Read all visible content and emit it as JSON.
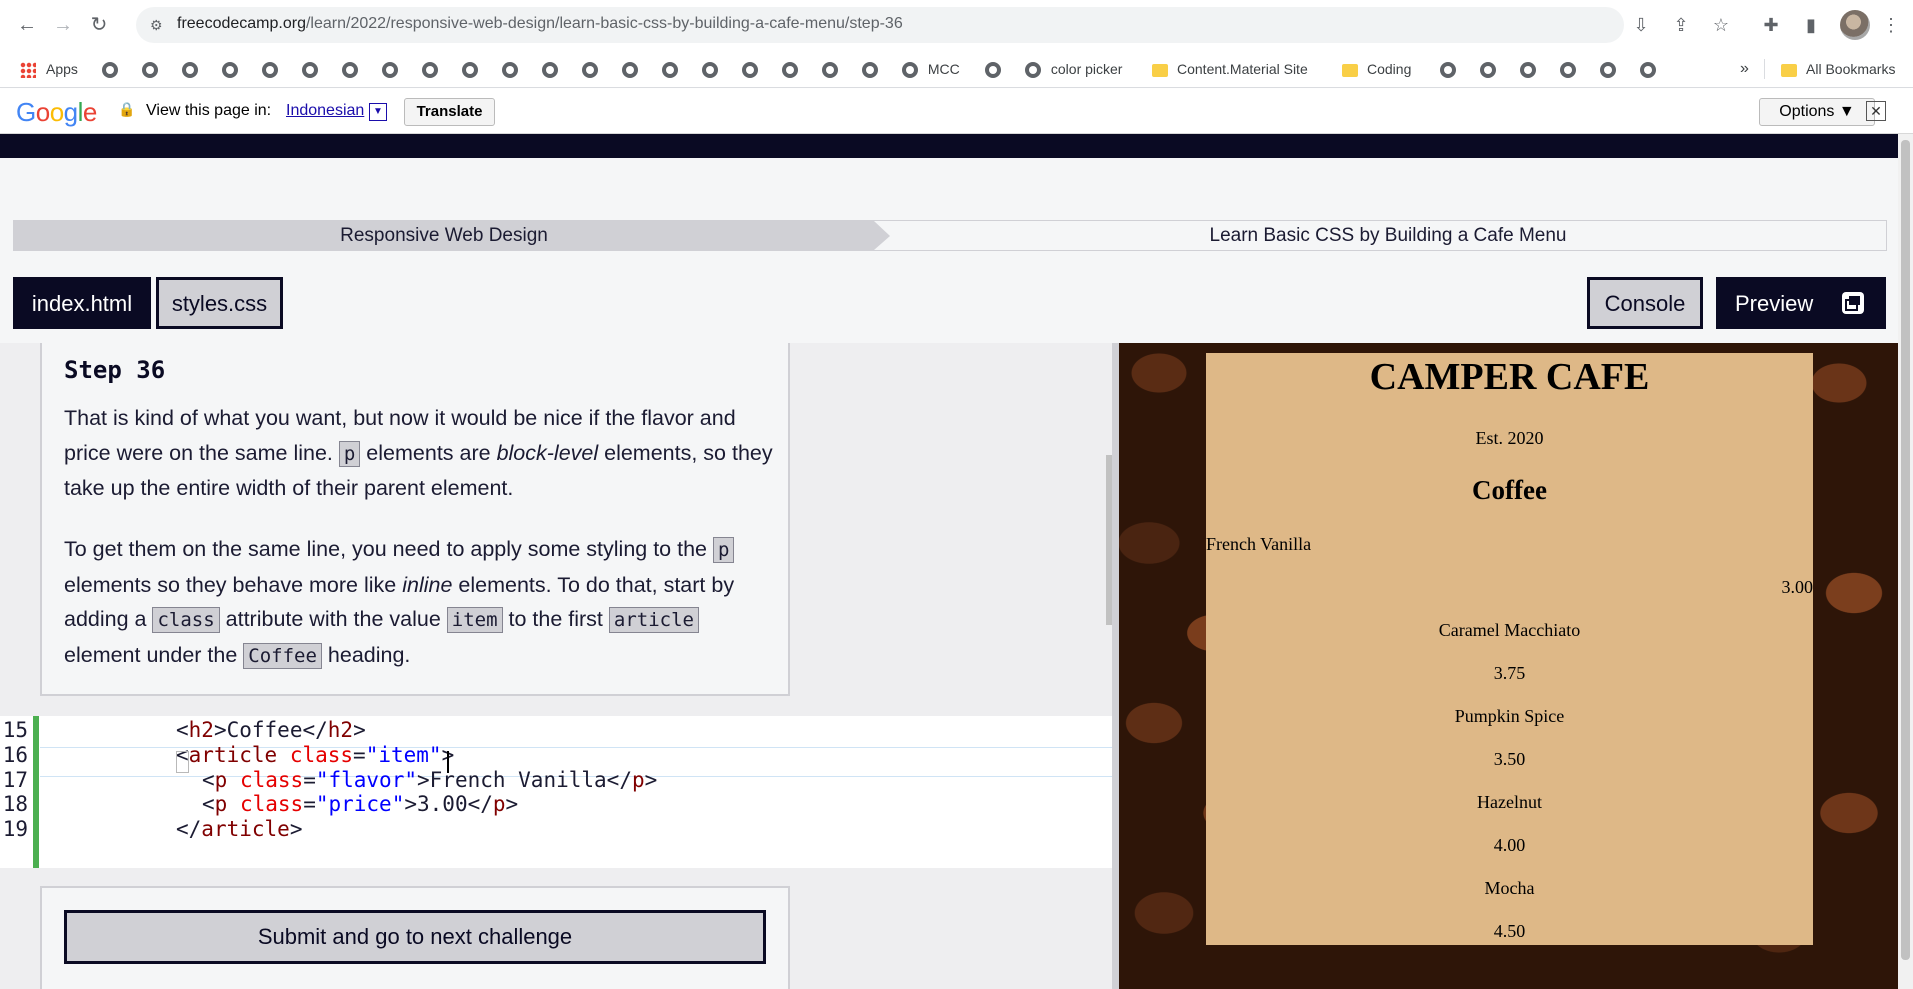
{
  "browser": {
    "url_domain": "freecodecamp.org",
    "url_path": "/learn/2022/responsive-web-design/learn-basic-css-by-building-a-cafe-menu/step-36",
    "bookmarks": {
      "apps": "Apps",
      "mcc": "MCC",
      "color_picker": "color picker",
      "content_material": "Content.Material Site",
      "coding": "Coding",
      "overflow": "»",
      "all_bookmarks": "All Bookmarks"
    }
  },
  "translate_bar": {
    "logo": "Google",
    "prompt": "View this page in:",
    "language": "Indonesian",
    "translate_label": "Translate",
    "options_label": "Options ▼",
    "close": "✕"
  },
  "breadcrumb": {
    "superblock": "Responsive Web Design",
    "block": "Learn Basic CSS by Building a Cafe Menu"
  },
  "tabs": {
    "html": "index.html",
    "css": "styles.css",
    "console": "Console",
    "preview": "Preview"
  },
  "instructions": {
    "step": "Step 36",
    "p1_a": "That is kind of what you want, but now it would be nice if the flavor and price were on the same line. ",
    "p1_code": "p",
    "p1_b": " elements are ",
    "p1_em": "block-level",
    "p1_c": " elements, so they take up the entire width of their parent element.",
    "p2_a": "To get them on the same line, you need to apply some styling to the ",
    "p2_code1": "p",
    "p2_b": " elements so they behave more like ",
    "p2_em": "inline",
    "p2_c": " elements. To do that, start by adding a ",
    "p2_code2": "class",
    "p2_d": " attribute with the value ",
    "p2_code3": "item",
    "p2_e": " to the first ",
    "p2_code4": "article",
    "p2_f": " element under the ",
    "p2_code5": "Coffee",
    "p2_g": " heading."
  },
  "editor": {
    "lines": [
      {
        "num": "15"
      },
      {
        "num": "16"
      },
      {
        "num": "17"
      },
      {
        "num": "18"
      },
      {
        "num": "19"
      }
    ],
    "l15": {
      "open": "<",
      "tag": "h2",
      "close": ">",
      "text": "Coffee",
      "end_open": "</",
      "end_tag": "h2",
      "end_close": ">"
    },
    "l16": {
      "open": "<",
      "tag": "article",
      "attr": "class",
      "eq": "=",
      "val": "\"item\"",
      "close": ">"
    },
    "l17": {
      "open": "<",
      "tag": "p",
      "attr": "class",
      "eq": "=",
      "val": "\"flavor\"",
      "gt": ">",
      "text": "French Vanilla",
      "end_open": "</",
      "end_tag": "p",
      "end_close": ">"
    },
    "l18": {
      "open": "<",
      "tag": "p",
      "attr": "class",
      "eq": "=",
      "val": "\"price\"",
      "gt": ">",
      "text": "3.00",
      "end_open": "</",
      "end_tag": "p",
      "end_close": ">"
    },
    "l19": {
      "open": "</",
      "tag": "article",
      "close": ">"
    }
  },
  "submit": {
    "label": "Submit and go to next challenge"
  },
  "preview_menu": {
    "title": "CAMPER CAFE",
    "est": "Est. 2020",
    "heading": "Coffee",
    "items": [
      {
        "flavor": "French Vanilla",
        "price": "3.00"
      },
      {
        "flavor": "Caramel Macchiato",
        "price": "3.75"
      },
      {
        "flavor": "Pumpkin Spice",
        "price": "3.50"
      },
      {
        "flavor": "Hazelnut",
        "price": "4.00"
      },
      {
        "flavor": "Mocha",
        "price": "4.50"
      }
    ]
  },
  "colors": {
    "fcc_dark": "#0a0a23",
    "fcc_gray": "#d0d0d5",
    "menu_bg": "#deb887",
    "gutter_green": "#4caf50"
  }
}
